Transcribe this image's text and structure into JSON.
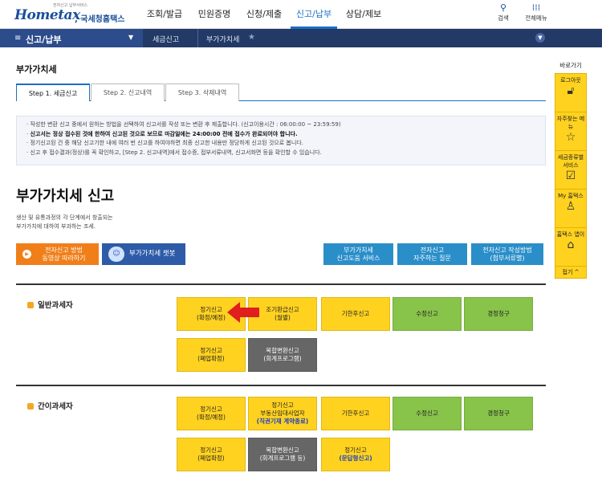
{
  "header": {
    "logo_tagline": "전자신고 납부서비스",
    "logo_brand": "Hometax",
    "logo_suffix": ", 국세청홈택스",
    "nav": [
      "조회/발급",
      "민원증명",
      "신청/제출",
      "신고/납부",
      "상담/제보"
    ],
    "active_nav_index": 3,
    "search_label": "검색",
    "all_menu_label": "전체메뉴"
  },
  "subbar": {
    "title": "신고/납부",
    "crumb1": "세금신고",
    "crumb2": "부가가치세"
  },
  "page": {
    "title": "부가가치세",
    "tabs": [
      "Step 1. 세금신고",
      "Step 2. 신고내역",
      "Step 3. 삭제내역"
    ],
    "notice": [
      "작성한 변환 신고 중에서 원하는 방법을 선택하여 신고서를 작성 또는 변환 후 제출합니다. (신고이용시간 : 06:00:00 ~ 23:59:59)",
      "신고서는 정상 접수된 것에 한하여 신고된 것으로 보므로 마감일에는 24:00:00 전에 접수가 완료되어야 합니다.",
      "정기신고된 건 중 해당 신고기한 내에 여러 번 신고를 하여야하면 최종 신고한 내용만 정당하게 신고된 것으로 봅니다.",
      "신고 후 접수결과(정상)를 꼭 확인하고, [Step 2. 신고내역]에서 접수증, 접부서류내역, 신고서화면 등을 확인할 수 있습니다."
    ],
    "big_title": "부가가치세 신고",
    "desc_line1": "생산 및 유통과정의 각 단계에서 창출되는",
    "desc_line2": "부가가치에 대하여 부과하는 조세.",
    "btn_video_1": "전자신고 방법",
    "btn_video_2": "동영상 따라하기",
    "btn_chatbot": "부가가치세 챗봇",
    "btn_help_1": "부가가치세",
    "btn_help_2": "신고도움 서비스",
    "btn_faq_1": "전자신고",
    "btn_faq_2": "자주하는 질문",
    "btn_guide_1": "전자신고 작성방법",
    "btn_guide_2": "(첨부서류별)"
  },
  "general": {
    "label": "일반과세자",
    "t1": [
      "정기신고",
      "(확정/예정)"
    ],
    "t2": [
      "조기환급신고",
      "(월별)"
    ],
    "t3": "기한후신고",
    "t4": "수정신고",
    "t5": "경정청구",
    "t6": [
      "정기신고",
      "(폐업확정)"
    ],
    "t7": [
      "복합변환신고",
      "(회계프로그램)"
    ]
  },
  "simple": {
    "label": "간이과세자",
    "t1": [
      "정기신고",
      "(확정/예정)"
    ],
    "t2": [
      "정기신고",
      "부동산임대사업자",
      "(직권기재 계약종료)"
    ],
    "t3": "기한후신고",
    "t4": "수정신고",
    "t5": "경정청구",
    "t6": [
      "정기신고",
      "(폐업확정)"
    ],
    "t7": [
      "복합변환신고",
      "(회계프로그램 등)"
    ],
    "t8": [
      "정기신고",
      "(문답형신고)"
    ]
  },
  "rail": {
    "title": "바로가기",
    "items": [
      "로그아웃",
      "자주찾는 메뉴",
      "세금종류별 서비스",
      "My 홈택스",
      "홈택스 앱이"
    ],
    "fold": "접기 ^"
  },
  "colors": {
    "nav_bar": "#233a66",
    "active_blue": "#1a6fc4",
    "tile_yellow": "#ffd21f",
    "tile_green": "#88c34a",
    "tile_dark": "#666666",
    "orange": "#f07f1a"
  }
}
